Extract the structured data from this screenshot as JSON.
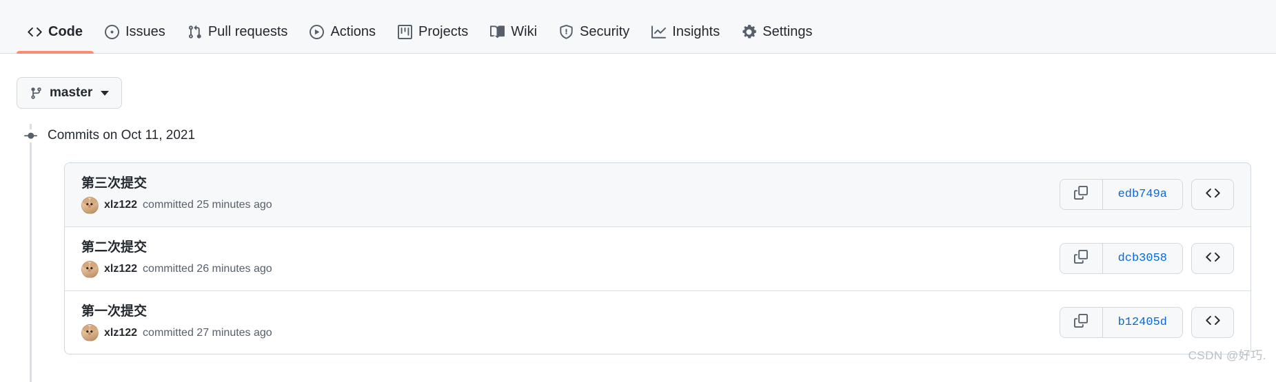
{
  "nav": {
    "items": [
      {
        "label": "Code",
        "icon": "code-icon",
        "selected": true
      },
      {
        "label": "Issues",
        "icon": "issue-opened-icon",
        "selected": false
      },
      {
        "label": "Pull requests",
        "icon": "git-pull-request-icon",
        "selected": false
      },
      {
        "label": "Actions",
        "icon": "play-icon",
        "selected": false
      },
      {
        "label": "Projects",
        "icon": "project-icon",
        "selected": false
      },
      {
        "label": "Wiki",
        "icon": "book-icon",
        "selected": false
      },
      {
        "label": "Security",
        "icon": "shield-icon",
        "selected": false
      },
      {
        "label": "Insights",
        "icon": "graph-icon",
        "selected": false
      },
      {
        "label": "Settings",
        "icon": "gear-icon",
        "selected": false
      }
    ],
    "active_underline_color": "#fd8c73"
  },
  "branch_selector": {
    "label": "master",
    "icon": "git-branch-icon"
  },
  "commit_group": {
    "title": "Commits on Oct 11, 2021",
    "icon": "commit-dot-icon"
  },
  "commits": [
    {
      "message": "第三次提交",
      "author": "xlz122",
      "meta": "committed 25 minutes ago",
      "sha": "edb749a",
      "copy_icon": "copy-icon",
      "browse_icon": "code-icon",
      "highlighted": true
    },
    {
      "message": "第二次提交",
      "author": "xlz122",
      "meta": "committed 26 minutes ago",
      "sha": "dcb3058",
      "copy_icon": "copy-icon",
      "browse_icon": "code-icon",
      "highlighted": false
    },
    {
      "message": "第一次提交",
      "author": "xlz122",
      "meta": "committed 27 minutes ago",
      "sha": "b12405d",
      "copy_icon": "copy-icon",
      "browse_icon": "code-icon",
      "highlighted": false
    }
  ],
  "watermark": "CSDN @好巧.",
  "colors": {
    "accent_link": "#0969da",
    "active_tab_underline": "#fd8c73",
    "nav_background": "#f6f8fa",
    "row_highlight": "#f6f8fa",
    "border": "#d0d7de"
  }
}
